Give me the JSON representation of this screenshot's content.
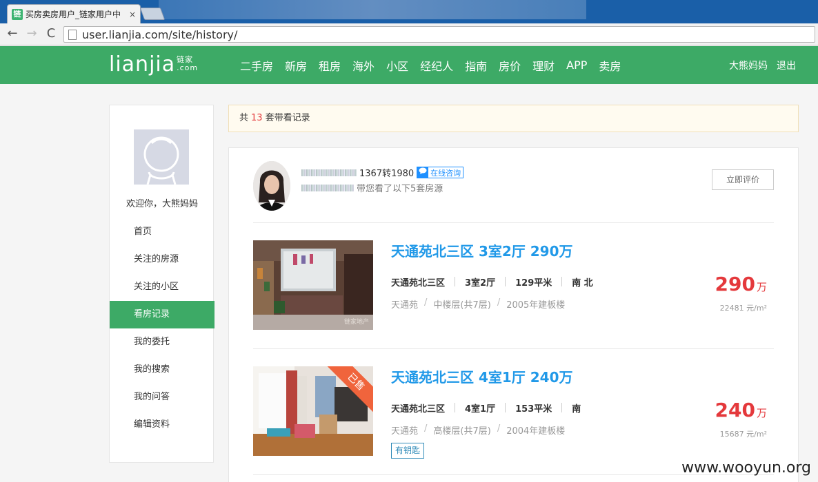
{
  "browser": {
    "tab_title": "买房卖房用户_链家用户中",
    "tab_close": "×",
    "favicon": "链",
    "back": "←",
    "forward": "→",
    "reload": "C",
    "url": "user.lianjia.com/site/history/"
  },
  "header": {
    "logo_main": "Lianjia",
    "logo_cn": "链家",
    "logo_com": ".com",
    "nav": [
      "二手房",
      "新房",
      "租房",
      "海外",
      "小区",
      "经纪人",
      "指南",
      "房价",
      "理财",
      "APP",
      "卖房"
    ],
    "username": "大熊妈妈",
    "logout": "退出",
    "brand_color": "#3daa66"
  },
  "sidebar": {
    "welcome": "欢迎你，大熊妈妈",
    "items": [
      "首页",
      "关注的房源",
      "关注的小区",
      "看房记录",
      "我的委托",
      "我的搜索",
      "我的问答",
      "编辑资料"
    ],
    "active_index": 3
  },
  "notice": {
    "prefix": "共",
    "count": "13",
    "suffix": "套带看记录"
  },
  "agent": {
    "phone_tail": "1367转1980",
    "consult_icon": "chat-bubble-icon",
    "consult_label": "在线咨询",
    "line2": "带您看了以下5套房源",
    "rate_label": "立即评价"
  },
  "houses": [
    {
      "title": "天通苑北三区 3室2厅 290万",
      "community": "天通苑北三区",
      "layout": "3室2厅",
      "area": "129平米",
      "orientation": "南 北",
      "district": "天通苑",
      "floor": "中楼层(共7层)",
      "year": "2005年建板楼",
      "price": "290",
      "price_unit": "万",
      "unit_price": "22481 元/m²",
      "img_watermark": "链家地产"
    },
    {
      "title": "天通苑北三区 4室1厅 240万",
      "community": "天通苑北三区",
      "layout": "4室1厅",
      "area": "153平米",
      "orientation": "南",
      "district": "天通苑",
      "floor": "高楼层(共7层)",
      "year": "2004年建板楼",
      "price": "240",
      "price_unit": "万",
      "unit_price": "15687 元/m²",
      "sold_label": "已售",
      "tag": "有钥匙"
    }
  ],
  "watermark": "www.wooyun.org"
}
